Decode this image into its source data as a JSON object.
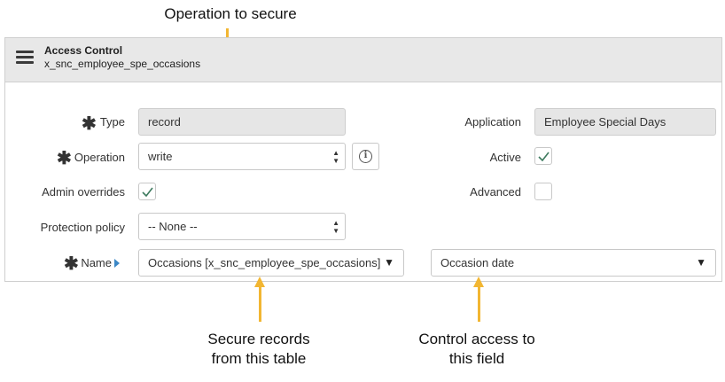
{
  "callouts": {
    "operation": "Operation to secure",
    "records_line1": "Secure records",
    "records_line2": "from this table",
    "field_line1": "Control access to",
    "field_line2": "this field"
  },
  "header": {
    "menu_icon": "hamburger-menu-icon",
    "title": "Access Control",
    "subtitle": "x_snc_employee_spe_occasions"
  },
  "form": {
    "type": {
      "label": "Type",
      "required": true,
      "value": "record"
    },
    "operation": {
      "label": "Operation",
      "required": true,
      "value": "write",
      "info_icon": "info-icon"
    },
    "admin_overrides": {
      "label": "Admin overrides",
      "checked": true
    },
    "protection_policy": {
      "label": "Protection policy",
      "value": "-- None --"
    },
    "name": {
      "label": "Name",
      "required": true,
      "table_value": "Occasions [x_snc_employee_spe_occasions]",
      "field_value": "Occasion date"
    },
    "application": {
      "label": "Application",
      "value": "Employee Special Days"
    },
    "active": {
      "label": "Active",
      "checked": true
    },
    "advanced": {
      "label": "Advanced",
      "checked": false
    }
  },
  "colors": {
    "callout_arrow": "#f2b632",
    "checkmark": "#3d7a5e",
    "header_bg": "#e8e8e8",
    "readonly_bg": "#e6e6e6",
    "name_indicator": "#3c88c6"
  }
}
